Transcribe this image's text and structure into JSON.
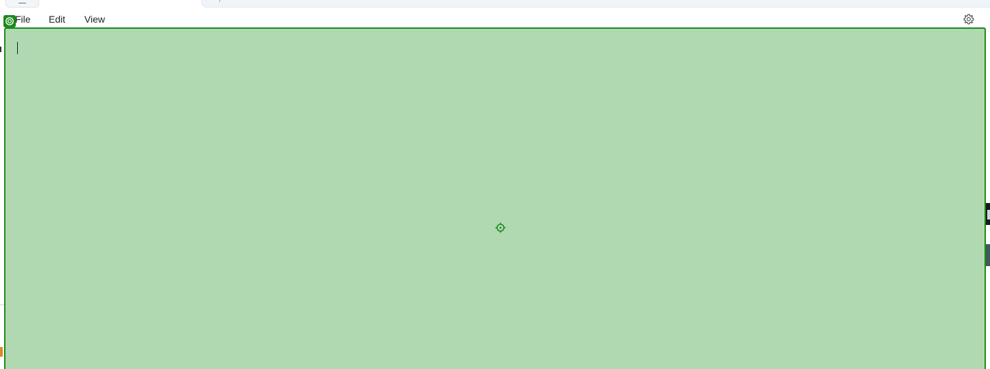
{
  "menu": {
    "file_label": "File",
    "edit_label": "Edit",
    "view_label": "View"
  },
  "icons": {
    "settings": "gear-icon",
    "tab_menu": "hamburger-icon",
    "target_badge": "target-icon",
    "crosshair": "crosshair-icon"
  },
  "colors": {
    "overlay_fill": "#b1d9b1",
    "overlay_border": "#1a8a1a",
    "window_background": "#ffffff",
    "text": "#1f1f1f"
  },
  "editor": {
    "content": ""
  }
}
